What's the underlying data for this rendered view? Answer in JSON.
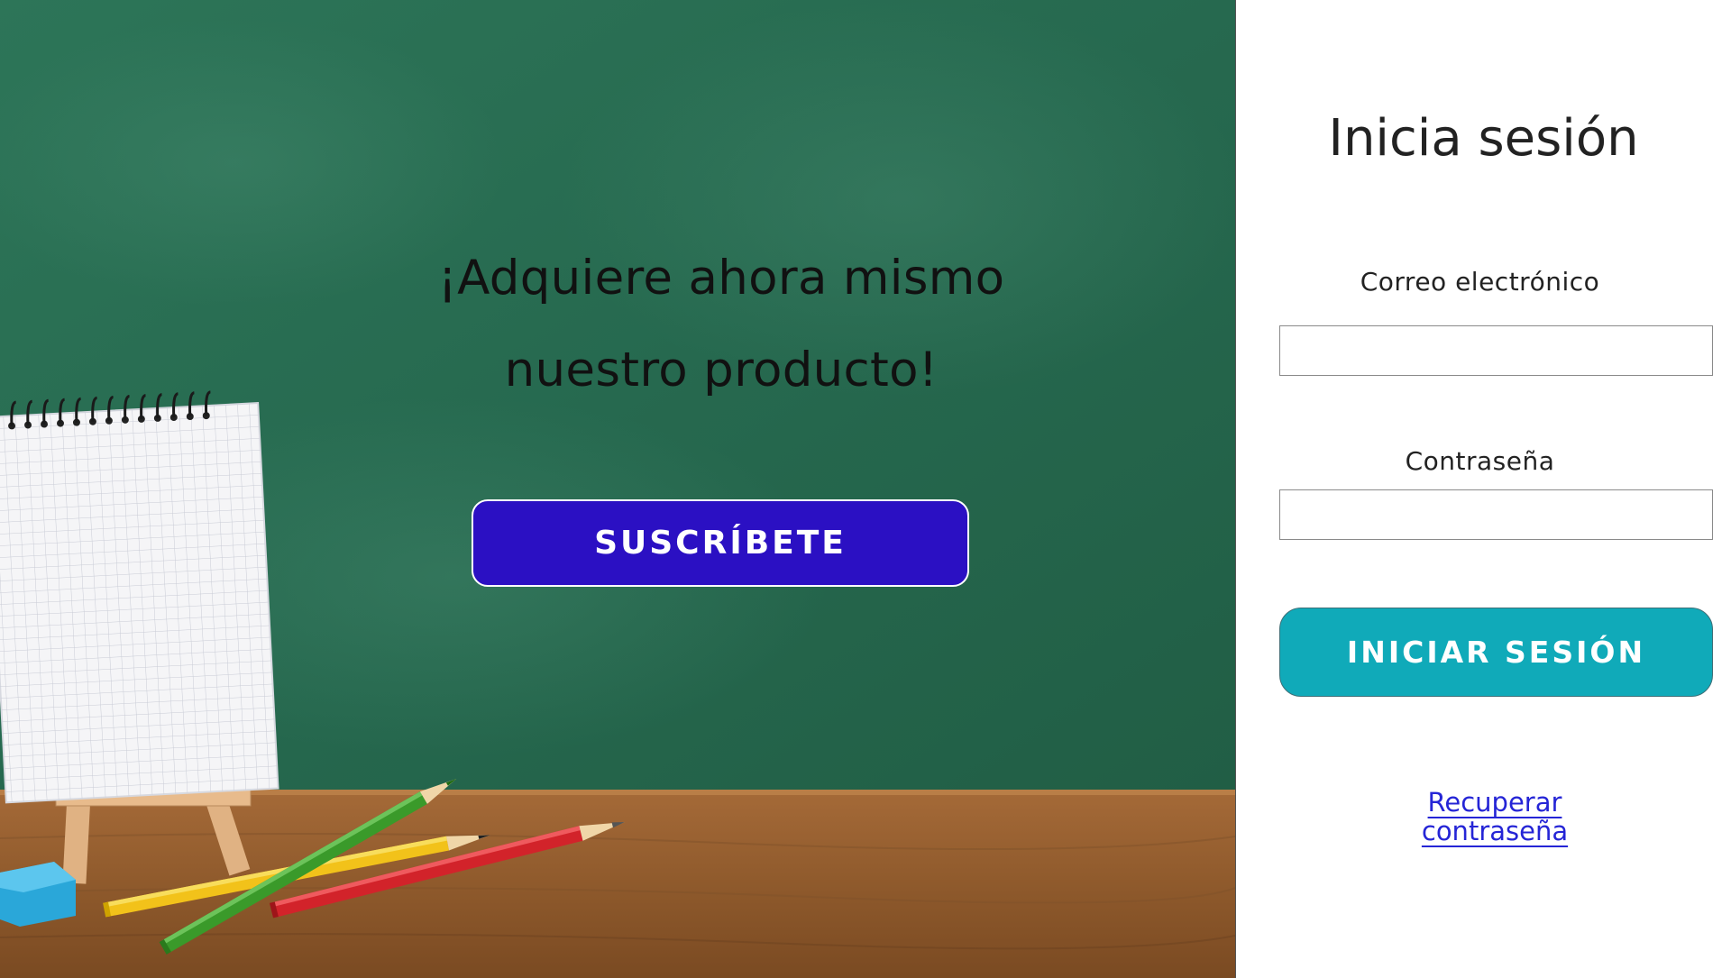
{
  "hero": {
    "headline_line1": "¡Adquiere ahora mismo",
    "headline_line2": "nuestro producto!",
    "subscribe_label": "SUSCRÍBETE",
    "background_image": "chalkboard-notebook-pencils"
  },
  "login": {
    "title": "Inicia sesión",
    "email_label": "Correo electrónico",
    "email_value": "",
    "password_label": "Contraseña",
    "password_value": "",
    "submit_label": "INICIAR SESIÓN",
    "recover_link": "Recuperar contraseña"
  },
  "colors": {
    "chalkboard": "#256e52",
    "subscribe_button": "#2b10c3",
    "login_button": "#10aab9",
    "link": "#2525d6",
    "text": "#222222"
  }
}
